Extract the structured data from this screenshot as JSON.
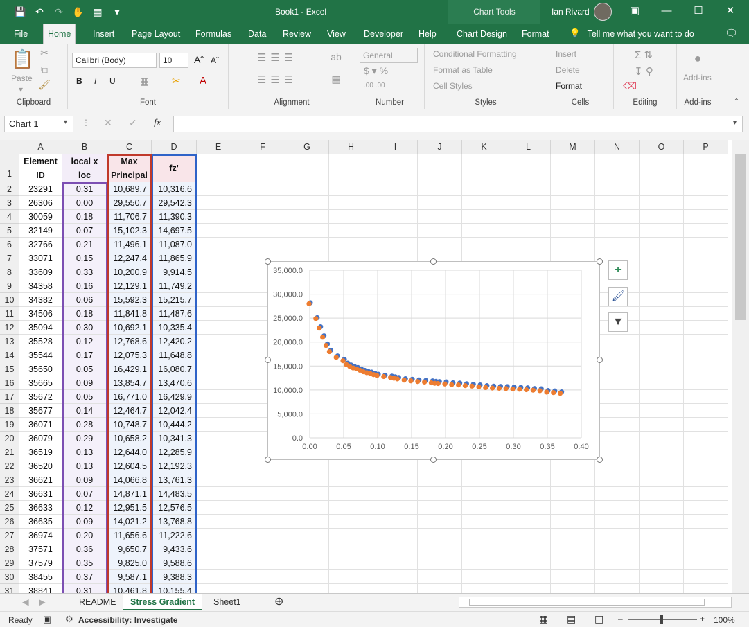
{
  "titlebar": {
    "doc_title": "Book1 - Excel",
    "context_label": "Chart Tools",
    "user_name": "Ian Rivard",
    "qat_icons": [
      "save-icon",
      "undo-icon",
      "redo-icon",
      "touch-mode-icon",
      "chart-icon",
      "customize-icon"
    ]
  },
  "tabs": [
    "File",
    "Home",
    "Insert",
    "Page Layout",
    "Formulas",
    "Data",
    "Review",
    "View",
    "Developer",
    "Help",
    "Chart Design",
    "Format"
  ],
  "active_tab": "Home",
  "tellme": "Tell me what you want to do",
  "ribbon": {
    "clipboard": {
      "paste": "Paste",
      "label": "Clipboard"
    },
    "font": {
      "name": "Calibri (Body)",
      "size": "10",
      "label": "Font"
    },
    "alignment": {
      "label": "Alignment"
    },
    "number": {
      "format": "General",
      "label": "Number"
    },
    "styles": {
      "conditional": "Conditional Formatting",
      "table": "Format as Table",
      "cell": "Cell Styles",
      "label": "Styles"
    },
    "cells": {
      "insert": "Insert",
      "delete": "Delete",
      "format": "Format",
      "label": "Cells"
    },
    "editing": {
      "label": "Editing"
    },
    "addins": {
      "button": "Add-ins",
      "label": "Add-ins"
    }
  },
  "formula_bar": {
    "name_box": "Chart 1",
    "fx": "fx",
    "content": ""
  },
  "columns": [
    "A",
    "B",
    "C",
    "D",
    "E",
    "F",
    "G",
    "H",
    "I",
    "J",
    "K",
    "L",
    "M",
    "N",
    "O",
    "P"
  ],
  "headers": {
    "A": [
      "Element",
      "ID"
    ],
    "B": [
      "local x",
      "loc"
    ],
    "C": [
      "Max",
      "Principal"
    ],
    "D": [
      "fz'"
    ]
  },
  "rows": [
    [
      "23291",
      "0.31",
      "10,689.7",
      "10,316.6"
    ],
    [
      "26306",
      "0.00",
      "29,550.7",
      "29,542.3"
    ],
    [
      "30059",
      "0.18",
      "11,706.7",
      "11,390.3"
    ],
    [
      "32149",
      "0.07",
      "15,102.3",
      "14,697.5"
    ],
    [
      "32766",
      "0.21",
      "11,496.1",
      "11,087.0"
    ],
    [
      "33071",
      "0.15",
      "12,247.4",
      "11,865.9"
    ],
    [
      "33609",
      "0.33",
      "10,200.9",
      "9,914.5"
    ],
    [
      "34358",
      "0.16",
      "12,129.1",
      "11,749.2"
    ],
    [
      "34382",
      "0.06",
      "15,592.3",
      "15,215.7"
    ],
    [
      "34506",
      "0.18",
      "11,841.8",
      "11,487.6"
    ],
    [
      "35094",
      "0.30",
      "10,692.1",
      "10,335.4"
    ],
    [
      "35528",
      "0.12",
      "12,768.6",
      "12,420.2"
    ],
    [
      "35544",
      "0.17",
      "12,075.3",
      "11,648.8"
    ],
    [
      "35650",
      "0.05",
      "16,429.1",
      "16,080.7"
    ],
    [
      "35665",
      "0.09",
      "13,854.7",
      "13,470.6"
    ],
    [
      "35672",
      "0.05",
      "16,771.0",
      "16,429.9"
    ],
    [
      "35677",
      "0.14",
      "12,464.7",
      "12,042.4"
    ],
    [
      "36071",
      "0.28",
      "10,748.7",
      "10,444.2"
    ],
    [
      "36079",
      "0.29",
      "10,658.2",
      "10,341.3"
    ],
    [
      "36519",
      "0.13",
      "12,644.0",
      "12,285.9"
    ],
    [
      "36520",
      "0.13",
      "12,604.5",
      "12,192.3"
    ],
    [
      "36621",
      "0.09",
      "14,066.8",
      "13,761.3"
    ],
    [
      "36631",
      "0.07",
      "14,871.1",
      "14,483.5"
    ],
    [
      "36633",
      "0.12",
      "12,951.5",
      "12,576.5"
    ],
    [
      "36635",
      "0.09",
      "14,021.2",
      "13,768.8"
    ],
    [
      "36974",
      "0.20",
      "11,656.6",
      "11,222.6"
    ],
    [
      "37571",
      "0.36",
      "9,650.7",
      "9,433.6"
    ],
    [
      "37579",
      "0.35",
      "9,825.0",
      "9,588.6"
    ],
    [
      "38455",
      "0.37",
      "9,587.1",
      "9,388.3"
    ],
    [
      "38841",
      "0.31",
      "10,461.8",
      "10,155.4"
    ]
  ],
  "chart_data": {
    "type": "scatter",
    "title": "",
    "xlabel": "",
    "ylabel": "",
    "xlim": [
      0,
      0.4
    ],
    "ylim": [
      0,
      35000
    ],
    "xticks": [
      "0.00",
      "0.05",
      "0.10",
      "0.15",
      "0.20",
      "0.25",
      "0.30",
      "0.35",
      "0.40"
    ],
    "yticks": [
      "0.0",
      "5,000.0",
      "10,000.0",
      "15,000.0",
      "20,000.0",
      "25,000.0",
      "30,000.0",
      "35,000.0"
    ],
    "grid": true,
    "series": [
      {
        "color": "#4472c4",
        "x": [
          0.0,
          0.01,
          0.015,
          0.02,
          0.025,
          0.03,
          0.04,
          0.05,
          0.055,
          0.06,
          0.065,
          0.07,
          0.075,
          0.08,
          0.085,
          0.09,
          0.095,
          0.1,
          0.11,
          0.12,
          0.125,
          0.13,
          0.14,
          0.15,
          0.16,
          0.17,
          0.18,
          0.185,
          0.19,
          0.2,
          0.21,
          0.22,
          0.23,
          0.24,
          0.25,
          0.26,
          0.27,
          0.28,
          0.29,
          0.3,
          0.31,
          0.32,
          0.33,
          0.34,
          0.35,
          0.36,
          0.37
        ],
        "y": [
          28200,
          25100,
          23200,
          21300,
          19600,
          18300,
          17100,
          16400,
          15600,
          15200,
          14900,
          14700,
          14400,
          14100,
          13900,
          13750,
          13500,
          13300,
          13100,
          12900,
          12750,
          12600,
          12350,
          12250,
          12100,
          12000,
          11900,
          11800,
          11750,
          11700,
          11500,
          11450,
          11300,
          11200,
          11050,
          10900,
          10800,
          10750,
          10700,
          10600,
          10550,
          10450,
          10300,
          10250,
          9900,
          9800,
          9600
        ]
      },
      {
        "color": "#ed7d31",
        "x": [
          0.0,
          0.01,
          0.015,
          0.02,
          0.025,
          0.03,
          0.04,
          0.05,
          0.055,
          0.06,
          0.065,
          0.07,
          0.075,
          0.08,
          0.085,
          0.09,
          0.095,
          0.1,
          0.11,
          0.12,
          0.125,
          0.13,
          0.14,
          0.15,
          0.16,
          0.17,
          0.18,
          0.185,
          0.19,
          0.2,
          0.21,
          0.22,
          0.23,
          0.24,
          0.25,
          0.26,
          0.27,
          0.28,
          0.29,
          0.3,
          0.31,
          0.32,
          0.33,
          0.34,
          0.35,
          0.36,
          0.37
        ],
        "y": [
          28000,
          24900,
          22900,
          21000,
          19300,
          18000,
          16800,
          16100,
          15300,
          14900,
          14600,
          14400,
          14100,
          13800,
          13600,
          13450,
          13200,
          13000,
          12800,
          12600,
          12450,
          12300,
          12050,
          11900,
          11750,
          11650,
          11500,
          11400,
          11350,
          11250,
          11100,
          11050,
          10900,
          10800,
          10650,
          10500,
          10400,
          10350,
          10300,
          10200,
          10150,
          10050,
          9950,
          9850,
          9550,
          9450,
          9300
        ]
      }
    ]
  },
  "sheets": [
    "README",
    "Stress Gradient",
    "Sheet1"
  ],
  "active_sheet": "Stress Gradient",
  "status": {
    "ready": "Ready",
    "accessibility": "Accessibility: Investigate",
    "zoom": "100%"
  }
}
